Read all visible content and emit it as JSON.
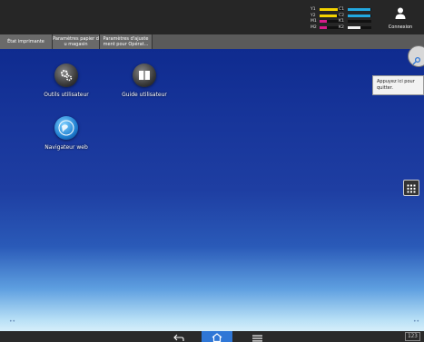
{
  "toners": {
    "left": [
      {
        "label": "Y1",
        "color": "#f4d300",
        "level": 0.75
      },
      {
        "label": "Y2",
        "color": "#f4d300",
        "level": 0.72
      },
      {
        "label": "M1",
        "color": "#d81b8a",
        "level": 0.3
      },
      {
        "label": "M2",
        "color": "#d81b8a",
        "level": 0.3
      }
    ],
    "right": [
      {
        "label": "C1",
        "color": "#22a8e0",
        "level": 0.95
      },
      {
        "label": "C2",
        "color": "#22a8e0",
        "level": 0.95
      },
      {
        "label": "K1",
        "color": "#f0f0f0",
        "level": 0.0
      },
      {
        "label": "K2",
        "color": "#f0f0f0",
        "level": 0.55
      }
    ]
  },
  "login": {
    "label": "Connexion",
    "icon": "user-icon"
  },
  "tabs": [
    {
      "label": "État imprimante"
    },
    {
      "label": "Paramètres papier d u magasin"
    },
    {
      "label": "Paramètres d'ajuste ment pour Opérat..."
    }
  ],
  "apps": [
    {
      "label": "Outils utilisateur",
      "icon": "gear-icon"
    },
    {
      "label": "Guide utilisateur",
      "icon": "book-icon"
    },
    {
      "label": "Navigateur web",
      "icon": "globe-icon"
    }
  ],
  "tooltip": {
    "text": "Appuyez ici pour quitter."
  },
  "bottom": {
    "back_icon": "back-arrow-icon",
    "home_icon": "home-icon",
    "menu_icon": "menu-icon",
    "counter": "123"
  },
  "colors": {
    "accent": "#2f77d6",
    "desktop_top": "#0f2b8f",
    "desktop_bottom": "#d6eefa"
  }
}
